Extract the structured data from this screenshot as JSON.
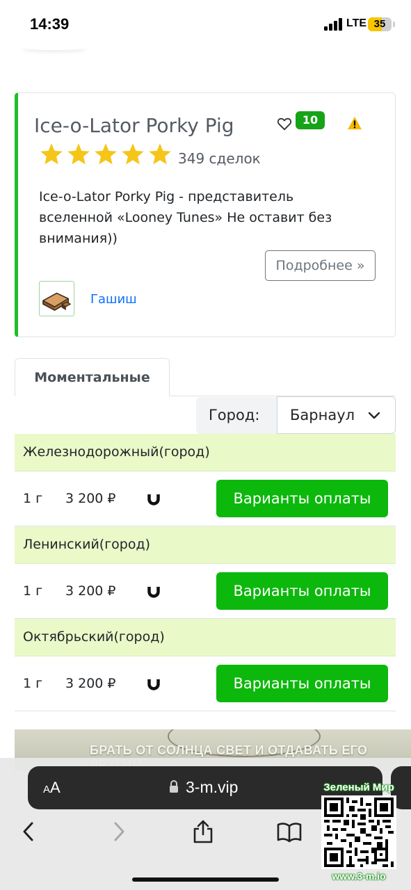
{
  "status_bar": {
    "time": "14:39",
    "network": "LTE",
    "battery": "35"
  },
  "product": {
    "title": "Ice-o-Lator Porky Pig",
    "favorites_count": "10",
    "rating_stars": 5,
    "deals": "349 сделок",
    "description": "Ice-o-Lator Porky Pig - представитель вселенной «Looney Tunes» Не оставит без внимания))",
    "more_label": "Подробнее »",
    "category": "Гашиш"
  },
  "tabs": [
    {
      "label": "Моментальные",
      "active": true
    }
  ],
  "city": {
    "label": "Город:",
    "value": "Барнаул"
  },
  "districts": [
    {
      "name": "Железнодорожный(город)",
      "offers": [
        {
          "qty": "1 г",
          "price": "3 200 ₽",
          "pay_label": "Варианты оплаты"
        }
      ]
    },
    {
      "name": "Ленинский(город)",
      "offers": [
        {
          "qty": "1 г",
          "price": "3 200 ₽",
          "pay_label": "Варианты оплаты"
        }
      ]
    },
    {
      "name": "Октябрьский(город)",
      "offers": [
        {
          "qty": "1 г",
          "price": "3 200 ₽",
          "pay_label": "Варианты оплаты"
        }
      ]
    }
  ],
  "banner": {
    "text": "БРАТЬ ОТ СОЛНЦА СВЕТ И ОТДАВАТЬ ЕГО ДРУГИМ"
  },
  "browser": {
    "aa_label": "AA",
    "url": "3-m.vip"
  },
  "watermark": {
    "title": "Зеленый Мир",
    "url": "www.3-m.io"
  },
  "colors": {
    "accent_green": "#0cb80c",
    "badge_green": "#17a317",
    "district_bg": "#e9f9c8",
    "link_blue": "#0d6efd",
    "star_yellow": "#f5c518"
  },
  "icons": [
    "heart-icon",
    "warning-icon",
    "star-icon",
    "chevron-down-icon",
    "magnet-icon",
    "lock-icon",
    "back-icon",
    "forward-icon",
    "share-icon",
    "bookmarks-icon"
  ]
}
